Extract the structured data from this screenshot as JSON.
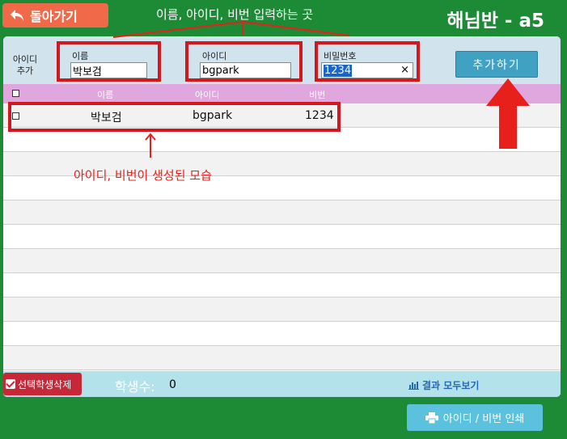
{
  "header": {
    "back_label": "돌아가기",
    "top_annotation": "이름, 아이디, 비번 입력하는 곳",
    "class_title": "해님반 - a5"
  },
  "form": {
    "section_label": "아이디 추가",
    "name_label": "이름",
    "name_value": "박보검",
    "id_label": "아이디",
    "id_value": "bgpark",
    "password_label": "비밀번호",
    "password_value": "1234",
    "clear_symbol": "×",
    "add_button_label": "추가하기"
  },
  "table": {
    "columns": [
      "이름",
      "아이디",
      "비번"
    ],
    "rows": [
      {
        "name": "박보검",
        "id": "bgpark",
        "password": "1234"
      }
    ]
  },
  "annotations": {
    "row_note": "아이디, 비번이 생성된 모습"
  },
  "footer": {
    "delete_label": "선택학생삭제",
    "count_label": "학생수:",
    "count_value": "0",
    "results_label": "결과 모두보기"
  },
  "print_button_label": "아이디 / 비번 인쇄",
  "colors": {
    "background": "#1d8a36",
    "back_button": "#f06a4a",
    "annotation_red": "#d3171e",
    "header_row": "#e0a6de",
    "add_button": "#41a1c2",
    "delete_button": "#c72837",
    "print_button": "#5bc1dc"
  }
}
